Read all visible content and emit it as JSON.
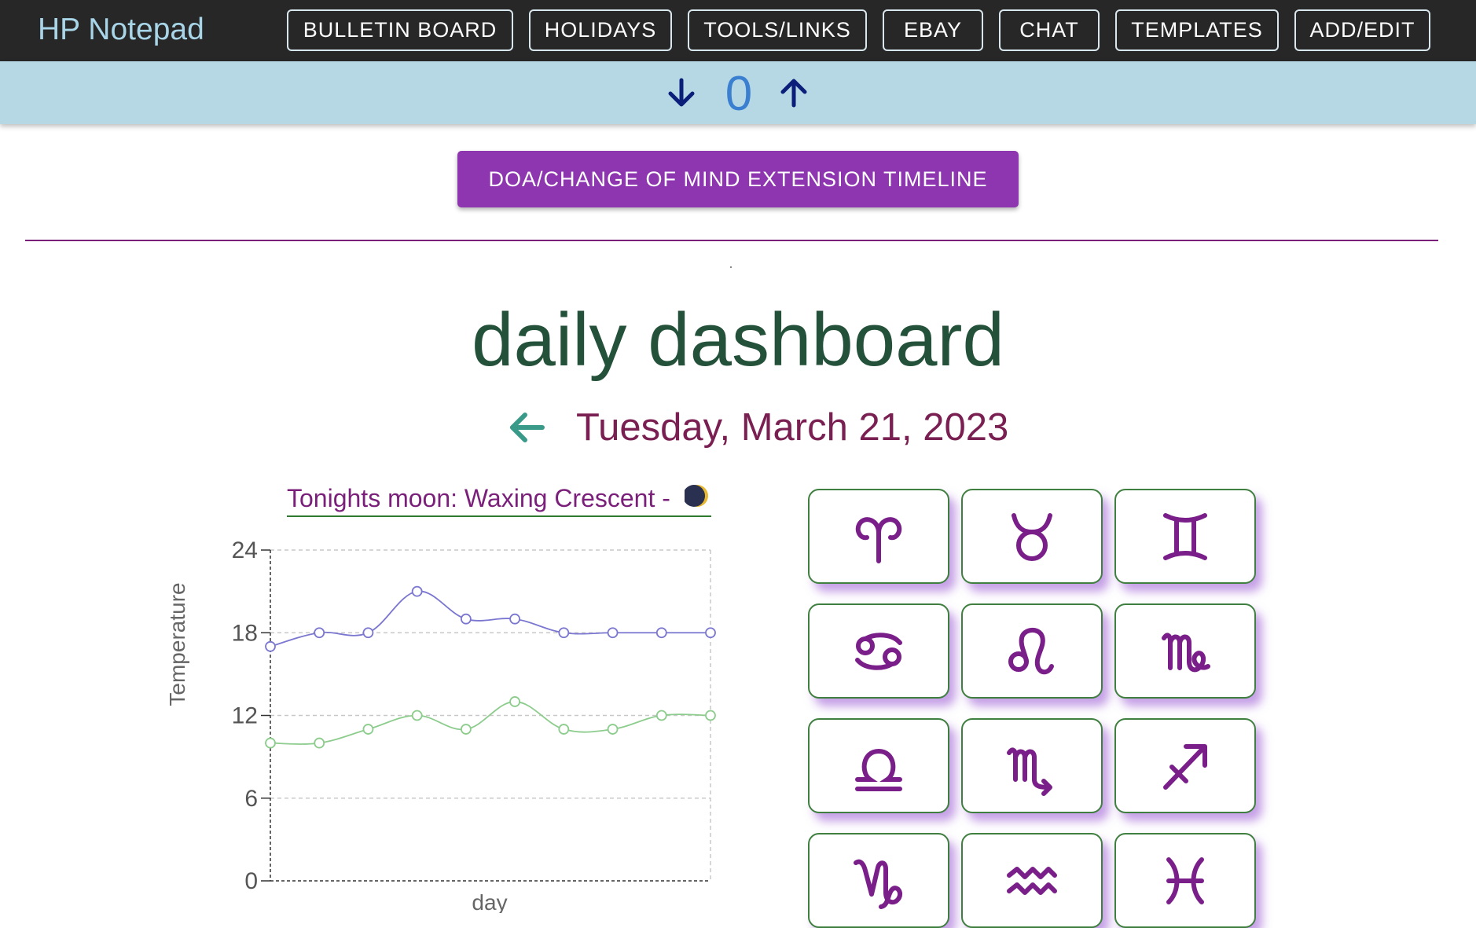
{
  "app": {
    "title": "HP Notepad"
  },
  "nav": {
    "items": [
      {
        "label": "BULLETIN BOARD"
      },
      {
        "label": "HOLIDAYS"
      },
      {
        "label": "TOOLS/LINKS"
      },
      {
        "label": "EBAY"
      },
      {
        "label": "CHAT"
      },
      {
        "label": "TEMPLATES"
      },
      {
        "label": "ADD/EDIT"
      }
    ]
  },
  "counter": {
    "value": "0",
    "down_icon": "arrow-down-icon",
    "up_icon": "arrow-up-icon"
  },
  "timeline_button": {
    "label": "DOA/CHANGE OF MIND EXTENSION TIMELINE"
  },
  "dashboard": {
    "title": "daily dashboard",
    "date": "Tuesday, March 21, 2023",
    "back_icon": "arrow-left-icon",
    "moon_text": "Tonights moon: Waxing Crescent -",
    "moon_icon": "waxing-crescent-moon-icon"
  },
  "chart_data": {
    "type": "line",
    "xlabel": "day",
    "ylabel": "Temperature",
    "ylim": [
      0,
      24
    ],
    "yticks": [
      0,
      6,
      12,
      18,
      24
    ],
    "x": [
      1,
      2,
      3,
      4,
      5,
      6,
      7,
      8,
      9,
      10
    ],
    "grid": true,
    "series": [
      {
        "values": [
          17,
          18,
          18,
          21,
          19,
          19,
          18,
          18,
          18,
          18
        ],
        "color": "#7b77d0"
      },
      {
        "values": [
          10,
          10,
          11,
          12,
          11,
          13,
          11,
          11,
          12,
          12
        ],
        "color": "#8ccc8c"
      }
    ]
  },
  "zodiac": {
    "color": "#7a1f8a",
    "signs": [
      {
        "icon": "aries-icon",
        "name": "aries"
      },
      {
        "icon": "taurus-icon",
        "name": "taurus"
      },
      {
        "icon": "gemini-icon",
        "name": "gemini"
      },
      {
        "icon": "cancer-icon",
        "name": "cancer"
      },
      {
        "icon": "leo-icon",
        "name": "leo"
      },
      {
        "icon": "virgo-icon",
        "name": "virgo"
      },
      {
        "icon": "libra-icon",
        "name": "libra"
      },
      {
        "icon": "scorpio-icon",
        "name": "scorpio"
      },
      {
        "icon": "sagittarius-icon",
        "name": "sagittarius"
      },
      {
        "icon": "capricorn-icon",
        "name": "capricorn"
      },
      {
        "icon": "aquarius-icon",
        "name": "aquarius"
      },
      {
        "icon": "pisces-icon",
        "name": "pisces"
      }
    ]
  }
}
